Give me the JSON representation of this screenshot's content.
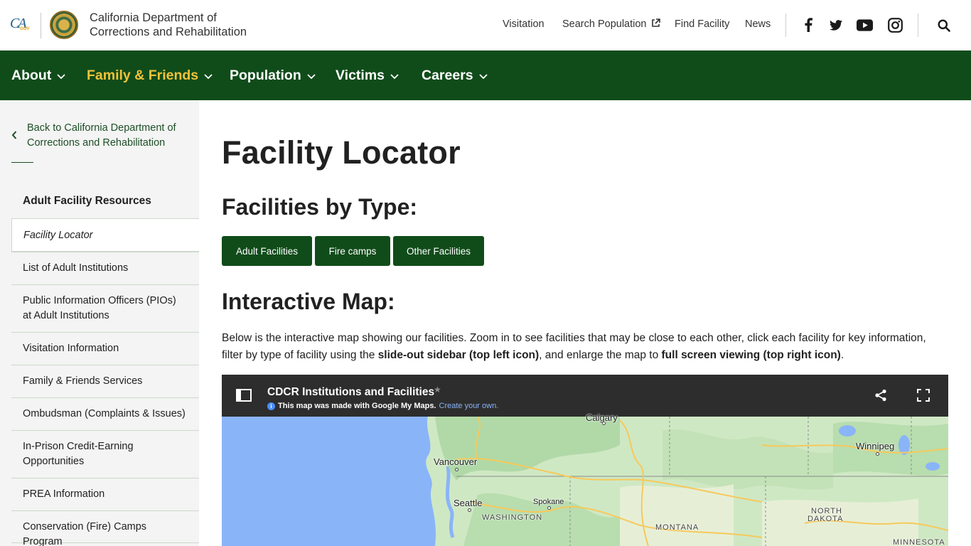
{
  "header": {
    "ca_logo_text": "CA",
    "ca_logo_suffix": "GOV",
    "dept_line1": "California Department of",
    "dept_line2": "Corrections and Rehabilitation",
    "utility_links": [
      {
        "label": "Visitation"
      },
      {
        "label": "Search Population",
        "external": true
      },
      {
        "label": "Find Facility"
      },
      {
        "label": "News"
      }
    ],
    "social_icons": [
      "facebook-icon",
      "twitter-icon",
      "youtube-icon",
      "instagram-icon"
    ],
    "search_icon": "search-icon"
  },
  "mainnav": {
    "items": [
      {
        "label": "About",
        "active": false
      },
      {
        "label": "Family & Friends",
        "active": true
      },
      {
        "label": "Population",
        "active": false
      },
      {
        "label": "Victims",
        "active": false
      },
      {
        "label": "Careers",
        "active": false
      }
    ],
    "active_color": "#f2c23b",
    "background_color": "#104c1a"
  },
  "sidebar": {
    "back_link": "Back to California Department of Corrections and Rehabilitation",
    "section_heading": "Adult Facility Resources",
    "items": [
      {
        "label": "Facility Locator",
        "current": true
      },
      {
        "label": "List of Adult Institutions"
      },
      {
        "label": "Public Information Officers (PIOs) at Adult Institutions"
      },
      {
        "label": "Visitation Information"
      },
      {
        "label": "Family & Friends Services"
      },
      {
        "label": "Ombudsman (Complaints & Issues)"
      },
      {
        "label": "In-Prison Credit-Earning Opportunities"
      },
      {
        "label": "PREA Information"
      },
      {
        "label": "Conservation (Fire) Camps Program"
      }
    ]
  },
  "content": {
    "title": "Facility Locator",
    "types_heading": "Facilities by Type:",
    "type_buttons": [
      "Adult Facilities",
      "Fire camps",
      "Other Facilities"
    ],
    "map_heading": "Interactive Map:",
    "intro_part1": "Below is the interactive map showing our facilities. Zoom in to see facilities that may be close to each other, click each facility for key information, filter by type of facility using the ",
    "intro_bold1": "slide-out sidebar (top left icon)",
    "intro_part2": ", and enlarge the map to ",
    "intro_bold2": "full screen viewing (top right icon)",
    "intro_part3": "."
  },
  "map": {
    "title": "CDCR Institutions and Facilities",
    "made_with": "This map was made with Google My Maps.",
    "create_link": "Create your own.",
    "labels": {
      "calgary": "Calgary",
      "winnipeg": "Winnipeg",
      "vancouver": "Vancouver",
      "seattle": "Seattle",
      "spokane": "Spokane",
      "washington": "WASHINGTON",
      "montana": "MONTANA",
      "north": "NORTH",
      "dakota": "DAKOTA",
      "minnesota": "MINNESOTA"
    },
    "colors": {
      "water": "#8ab4f8",
      "land": "#cfe8c4",
      "forest": "#a8d5a0",
      "roads": "#f7c95a"
    }
  }
}
